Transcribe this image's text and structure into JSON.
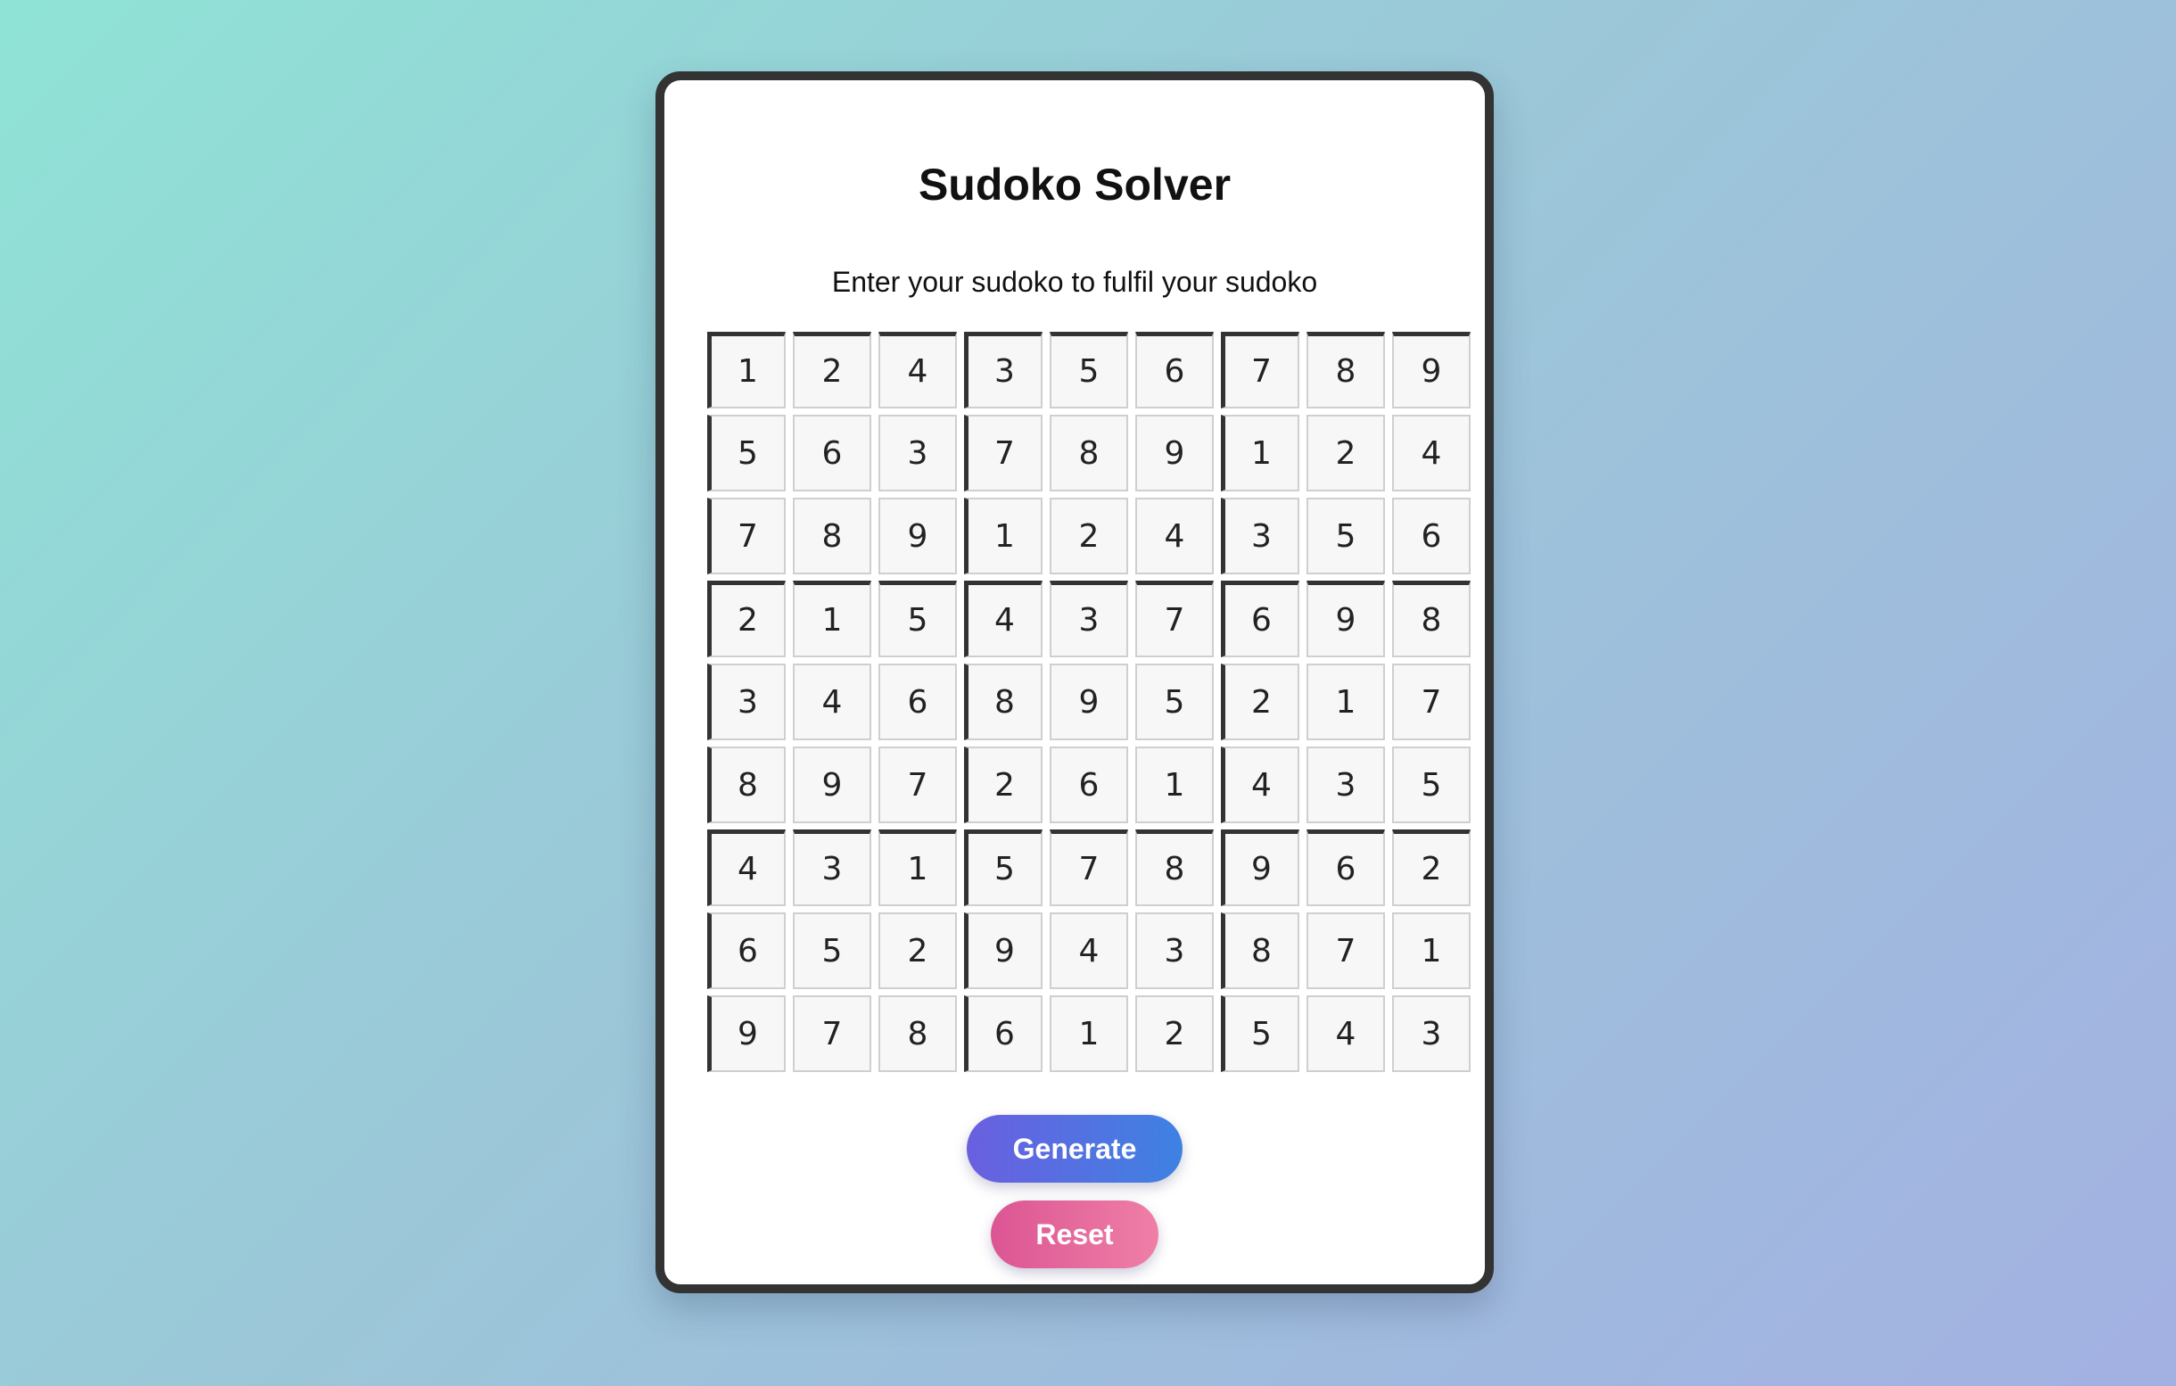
{
  "app": {
    "title": "Sudoko Solver",
    "subtitle": "Enter your sudoko to fulfil your sudoko"
  },
  "grid": {
    "rows": [
      [
        "1",
        "2",
        "4",
        "3",
        "5",
        "6",
        "7",
        "8",
        "9"
      ],
      [
        "5",
        "6",
        "3",
        "7",
        "8",
        "9",
        "1",
        "2",
        "4"
      ],
      [
        "7",
        "8",
        "9",
        "1",
        "2",
        "4",
        "3",
        "5",
        "6"
      ],
      [
        "2",
        "1",
        "5",
        "4",
        "3",
        "7",
        "6",
        "9",
        "8"
      ],
      [
        "3",
        "4",
        "6",
        "8",
        "9",
        "5",
        "2",
        "1",
        "7"
      ],
      [
        "8",
        "9",
        "7",
        "2",
        "6",
        "1",
        "4",
        "3",
        "5"
      ],
      [
        "4",
        "3",
        "1",
        "5",
        "7",
        "8",
        "9",
        "6",
        "2"
      ],
      [
        "6",
        "5",
        "2",
        "9",
        "4",
        "3",
        "8",
        "7",
        "1"
      ],
      [
        "9",
        "7",
        "8",
        "6",
        "1",
        "2",
        "5",
        "4",
        "3"
      ]
    ]
  },
  "buttons": {
    "generate_label": "Generate",
    "reset_label": "Reset"
  },
  "colors": {
    "generate_start": "#6a5fe0",
    "generate_end": "#3e82e2",
    "reset_start": "#dc5593",
    "reset_end": "#ef7fa7",
    "card_border": "#333333"
  }
}
